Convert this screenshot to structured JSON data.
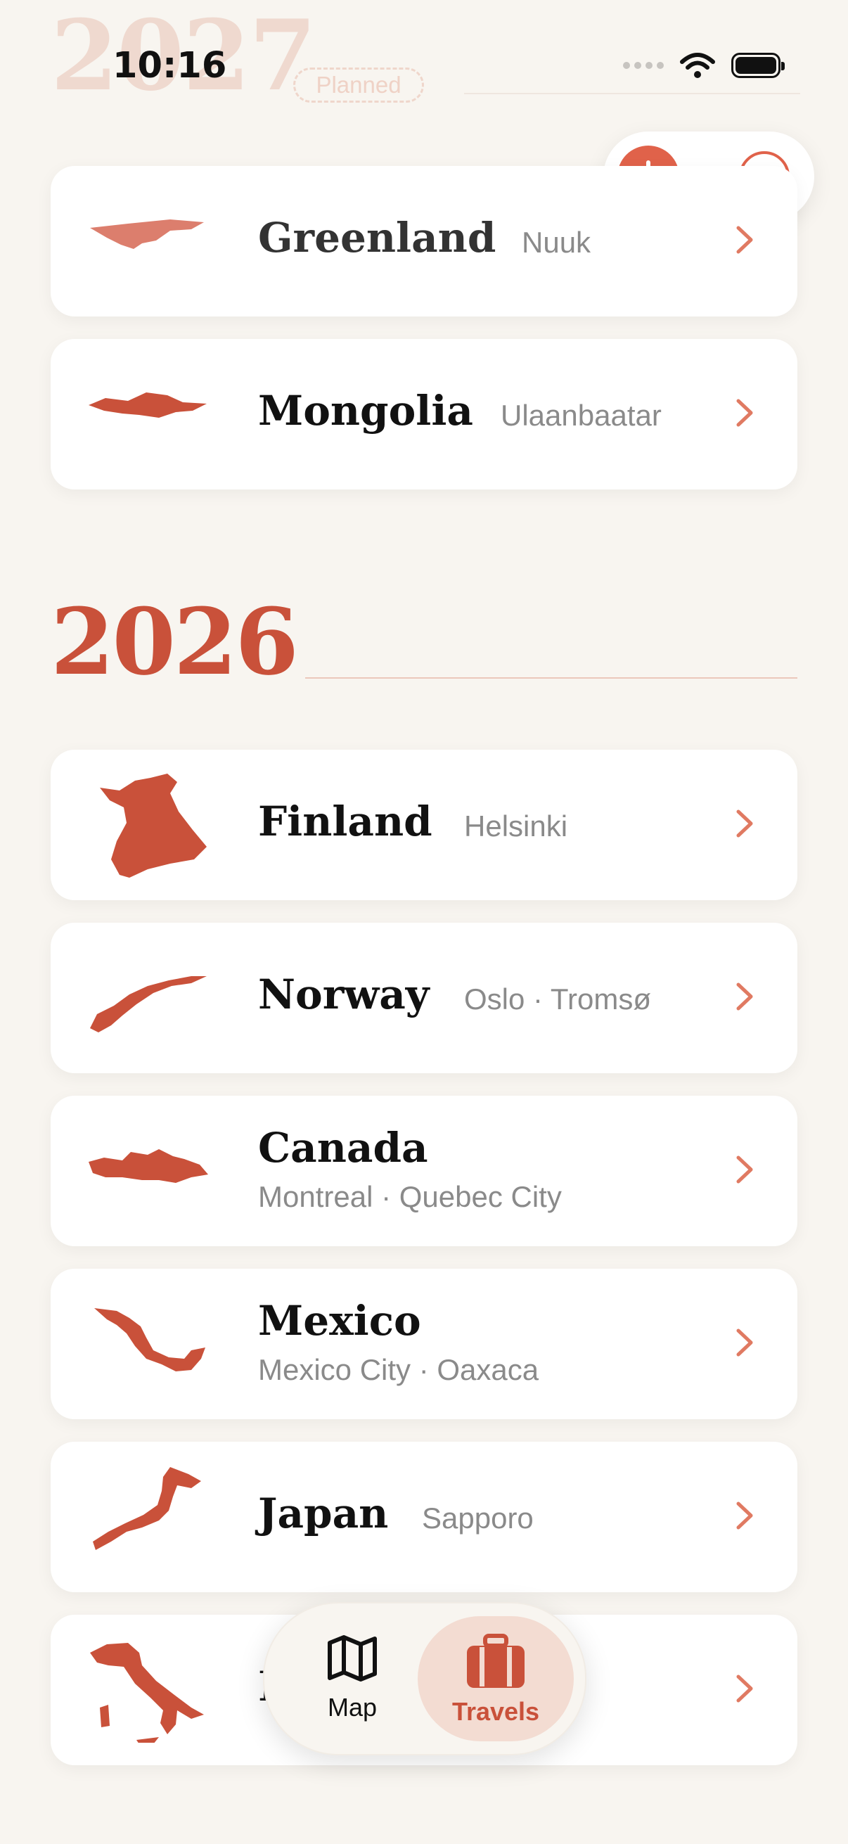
{
  "status_bar": {
    "time": "10:16"
  },
  "sections": [
    {
      "year": "2027",
      "tag": "Planned",
      "trips": [
        {
          "country": "Greenland",
          "cities": "Nuuk"
        },
        {
          "country": "Mongolia",
          "cities": "Ulaanbaatar"
        }
      ]
    },
    {
      "year": "2026",
      "trips": [
        {
          "country": "Finland",
          "cities": "Helsinki"
        },
        {
          "country": "Norway",
          "cities": "Oslo · Tromsø"
        },
        {
          "country": "Canada",
          "cities": "Montreal · Quebec City"
        },
        {
          "country": "Mexico",
          "cities": "Mexico City · Oaxaca"
        },
        {
          "country": "Japan",
          "cities": "Sapporo"
        },
        {
          "country": "I",
          "cities": ""
        }
      ]
    }
  ],
  "tab_bar": {
    "map_label": "Map",
    "travels_label": "Travels",
    "selected": "Travels"
  },
  "colors": {
    "accent": "#e0624a",
    "year_accent": "#c9513a",
    "background": "#f8f5f0",
    "card": "#ffffff"
  },
  "icons": [
    "plus-icon",
    "ellipsis-icon",
    "map-icon",
    "suitcase-icon",
    "chevron-right-icon",
    "wifi-icon",
    "battery-icon",
    "signal-icon"
  ]
}
